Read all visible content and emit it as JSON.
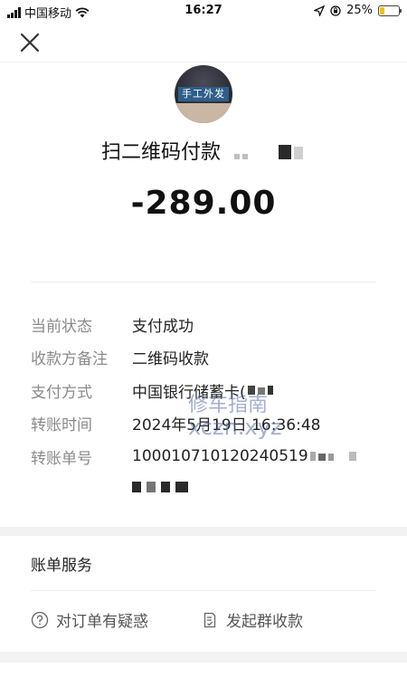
{
  "status_bar": {
    "carrier": "中国移动",
    "time": "16:27",
    "battery": "25%",
    "battery_level": 0.25
  },
  "nav": {
    "close_icon": "close-icon"
  },
  "payment": {
    "title": "扫二维码付款",
    "amount": "-289.00",
    "avatar_sign_text": "手工外发"
  },
  "details": [
    {
      "label": "当前状态",
      "value": "支付成功"
    },
    {
      "label": "收款方备注",
      "value": "二维码收款"
    },
    {
      "label": "支付方式",
      "value": "中国银行储蓄卡("
    },
    {
      "label": "转账时间",
      "value": "2024年5月19日 16:36:48"
    },
    {
      "label": "转账单号",
      "value": "100010710120240519"
    }
  ],
  "watermark": {
    "line1": "修车指南",
    "line2": "xczn.xyz"
  },
  "bill_services": {
    "title": "账单服务",
    "items": [
      {
        "label": "对订单有疑惑",
        "icon": "question-circle-icon"
      },
      {
        "label": "发起群收款",
        "icon": "document-check-icon"
      }
    ]
  },
  "colors": {
    "label_gray": "#8a8a8a",
    "band_gray": "#f2f2f2",
    "battery_yellow": "#f2c200"
  }
}
